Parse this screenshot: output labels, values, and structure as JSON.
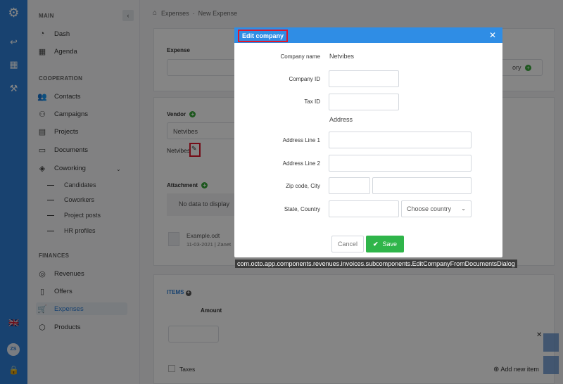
{
  "breadcrumb": {
    "section": "Expenses",
    "separator": "·",
    "page": "New Expense"
  },
  "sidebar": {
    "sections": {
      "main": "MAIN",
      "cooperation": "COOPERATION",
      "finances": "FINANCES"
    },
    "items": {
      "dash": "Dash",
      "agenda": "Agenda",
      "contacts": "Contacts",
      "campaigns": "Campaigns",
      "projects": "Projects",
      "documents": "Documents",
      "coworking": "Coworking",
      "candidates": "Candidates",
      "coworkers": "Coworkers",
      "project_posts": "Project posts",
      "hr_profiles": "HR profiles",
      "revenues": "Revenues",
      "offers": "Offers",
      "expenses": "Expenses",
      "products": "Products"
    },
    "active": "expenses"
  },
  "rail": {
    "avatar": "ZS",
    "flag": "🇬🇧"
  },
  "form": {
    "expense_label": "Expense",
    "category_fragment": "ory",
    "vendor_label": "Vendor",
    "vendor_value": "Netvibes",
    "vendor_link": "Netvibes",
    "attachment_label": "Attachment",
    "no_data": "No data to display",
    "file_name": "Example.odt",
    "file_meta": "11-03-2021 | Zanet",
    "items_label": "ITEMS",
    "amount_label": "Amount",
    "taxes_label": "Taxes",
    "add_item": "Add new item"
  },
  "dialog": {
    "title": "Edit company",
    "company_name_label": "Company name",
    "company_name_value": "Netvibes",
    "company_id_label": "Company ID",
    "company_id_value": "",
    "tax_id_label": "Tax ID",
    "tax_id_value": "",
    "address_heading": "Address",
    "address1_label": "Address Line 1",
    "address1_value": "",
    "address2_label": "Address Line 2",
    "address2_value": "",
    "zip_city_label": "Zip code, City",
    "zip_value": "",
    "city_value": "",
    "state_country_label": "State, Country",
    "state_value": "",
    "country_placeholder": "Choose country",
    "cancel_label": "Cancel",
    "save_label": "Save"
  },
  "tooltip": "com.octo.app.components.revenues.invoices.subcomponents.EditCompanyFromDocumentsDialog",
  "colors": {
    "rail": "#2f7fd6",
    "dialog_header": "#2f8de5",
    "save": "#2fb54a",
    "highlight": "#e0162b"
  }
}
